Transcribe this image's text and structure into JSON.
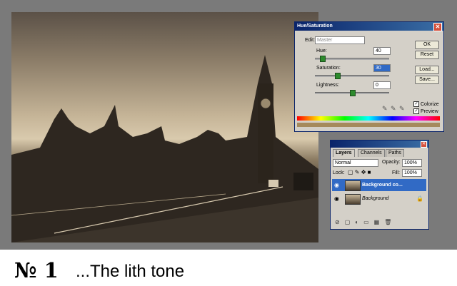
{
  "hue_saturation": {
    "title": "Hue/Saturation",
    "edit_label": "Edit:",
    "edit_value": "Master",
    "hue_label": "Hue:",
    "hue_value": "40",
    "saturation_label": "Saturation:",
    "saturation_value": "30",
    "lightness_label": "Lightness:",
    "lightness_value": "0",
    "buttons": {
      "ok": "OK",
      "reset": "Reset",
      "load": "Load...",
      "save": "Save..."
    },
    "colorize_label": "Colorize",
    "preview_label": "Preview",
    "colorize_checked": true,
    "preview_checked": true
  },
  "layers_panel": {
    "tabs": [
      "Layers",
      "Channels",
      "Paths"
    ],
    "blend_mode": "Normal",
    "opacity_label": "Opacity:",
    "opacity_value": "100%",
    "lock_label": "Lock:",
    "fill_label": "Fill:",
    "fill_value": "100%",
    "layers": [
      {
        "name": "Background co...",
        "selected": true
      },
      {
        "name": "Background",
        "selected": false
      }
    ]
  },
  "caption": {
    "number": "№ 1",
    "text": "...The lith tone"
  },
  "colors": {
    "titlebar": "#0a246a",
    "selected_layer": "#316ac5",
    "sepia": "#c5b497"
  }
}
